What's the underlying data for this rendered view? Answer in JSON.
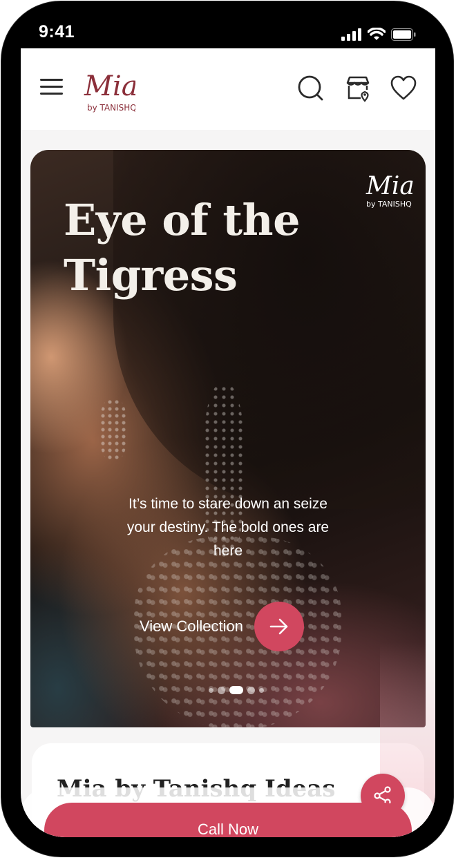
{
  "status_bar": {
    "time": "9:41"
  },
  "header": {
    "logo_text": "Mia",
    "logo_subtext": "by TANISHQ",
    "icons": [
      "menu-icon",
      "search-icon",
      "store-locator-icon",
      "heart-icon"
    ]
  },
  "hero": {
    "title_line1": "Eye of the",
    "title_line2": "Tigress",
    "subtitle": "It’s time to stare down an seize your destiny. The bold ones are here",
    "cta_label": "View Collection",
    "slides_total": 5,
    "active_slide": 3,
    "logo_text": "Mia",
    "logo_subtext": "by TANISHQ"
  },
  "card": {
    "title": "Mia by Tanishq Ideas"
  },
  "actions": {
    "call_label": "Call Now"
  },
  "colors": {
    "accent": "#d1475f",
    "logo": "#8b2f3a",
    "frame": "#000000"
  }
}
